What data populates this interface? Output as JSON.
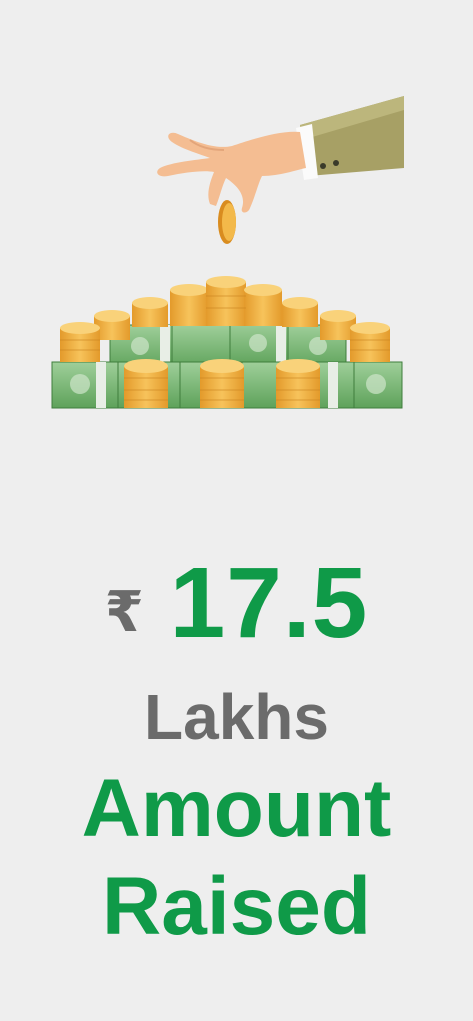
{
  "stat": {
    "currency_symbol": "₹",
    "amount": "17.5",
    "unit": "Lakhs",
    "caption_line1": "Amount",
    "caption_line2": "Raised"
  },
  "colors": {
    "background": "#eeeeee",
    "accent_green": "#0f9a48",
    "muted_gray": "#6b6b6b"
  },
  "illustration": {
    "icon": "hand-dropping-coin-onto-money-pile-icon"
  }
}
